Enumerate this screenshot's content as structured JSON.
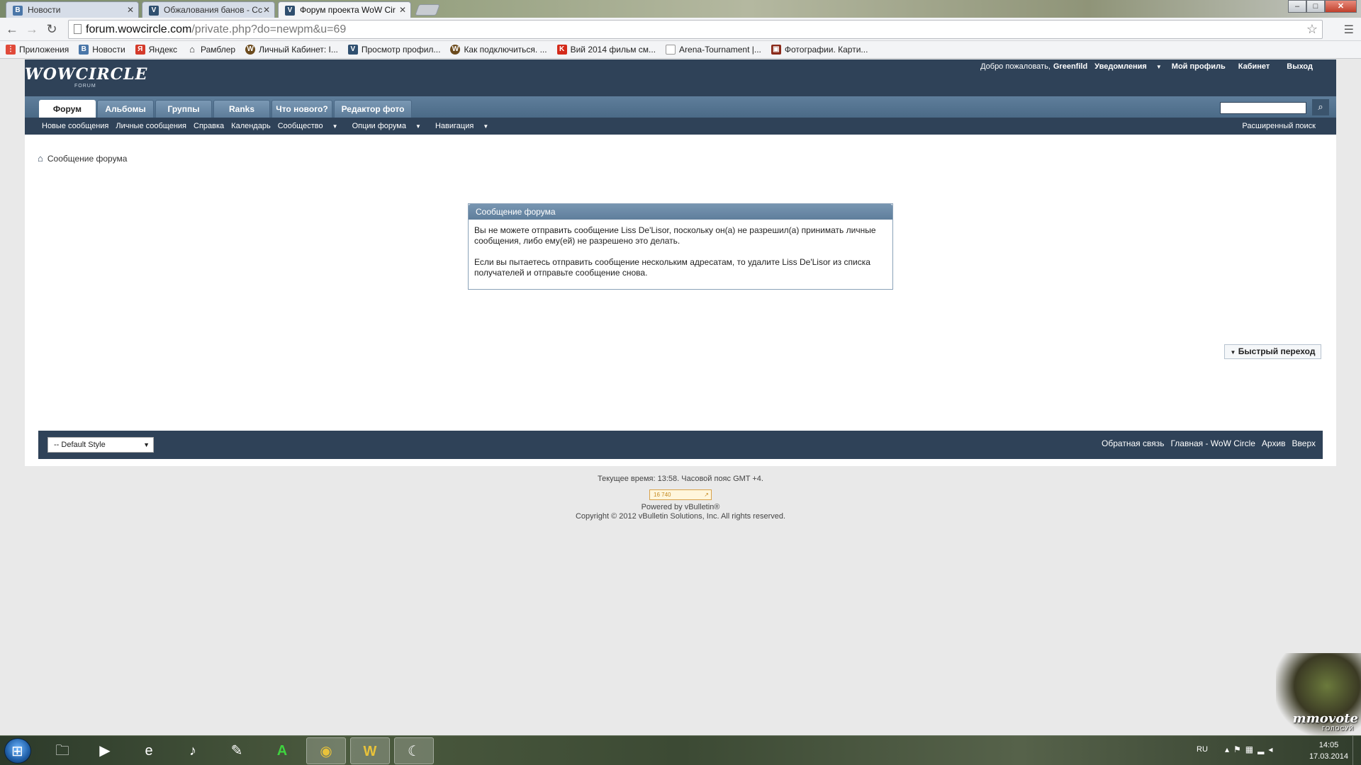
{
  "browser": {
    "tabs": [
      {
        "label": "Новости",
        "favicon": "vk-icon",
        "active": false
      },
      {
        "label": "Обжалования банов - Cc",
        "favicon": "vbulletin-icon",
        "active": false
      },
      {
        "label": "Форум проекта WoW Cir",
        "favicon": "vbulletin-icon",
        "active": true
      }
    ],
    "window_buttons": {
      "minimize": "–",
      "maximize": "□",
      "close": "✕"
    },
    "url_host": "forum.wowcircle.com",
    "url_path": "/private.php?do=newpm&u=69",
    "bookmarks": [
      {
        "label": "Приложения",
        "icon": "apps-grid-icon",
        "color": "#e04a3a"
      },
      {
        "label": "Новости",
        "icon": "vk-icon",
        "color": "#4a76a8"
      },
      {
        "label": "Яндекс",
        "icon": "yandex-icon",
        "color": "#d43a2a"
      },
      {
        "label": "Рамблер",
        "icon": "home-icon",
        "color": "#333333"
      },
      {
        "label": "Личный Кабинет: I...",
        "icon": "wow-icon",
        "color": "#6b4a1c"
      },
      {
        "label": "Просмотр профил...",
        "icon": "vbulletin-icon",
        "color": "#2f4f6f"
      },
      {
        "label": "Как подключиться. ...",
        "icon": "wow-icon",
        "color": "#6b4a1c"
      },
      {
        "label": "Вий 2014 фильм см...",
        "icon": "kinopoisk-icon",
        "color": "#d42a1a"
      },
      {
        "label": "Arena-Tournament |...",
        "icon": "page-icon",
        "color": "#ffffff"
      },
      {
        "label": "Фотографии. Карти...",
        "icon": "photo-icon",
        "color": "#8a2a1a"
      }
    ]
  },
  "forum": {
    "logo": "WOWCIRCLE",
    "logo_sub": "FORUM",
    "top_links": {
      "welcome": "Добро пожаловать,",
      "username": "Greenfild",
      "notifications": "Уведомления",
      "profile": "Мой профиль",
      "cabinet": "Кабинет",
      "logout": "Выход"
    },
    "nav_tabs": [
      "Форум",
      "Альбомы",
      "Группы",
      "Ranks",
      "Что нового?",
      "Редактор фото"
    ],
    "sub_nav": [
      "Новые сообщения",
      "Личные сообщения",
      "Справка",
      "Календарь",
      "Сообщество",
      "Опции форума",
      "Навигация"
    ],
    "advanced_search": "Расширенный поиск",
    "breadcrumb": "Сообщение форума",
    "message_box": {
      "title": "Сообщение форума",
      "paragraph1": "Вы не можете отправить сообщение Liss De'Lisor, поскольку он(а) не разрешил(а) принимать личные сообщения, либо ему(ей) не разрешено это делать.",
      "paragraph2": "Если вы пытаетесь отправить сообщение нескольким адресатам, то удалите Liss De'Lisor из списка получателей и отправьте сообщение снова."
    },
    "quick_nav": "Быстрый переход",
    "style_select": "-- Default Style",
    "footer_links": [
      "Обратная связь",
      "Главная - WoW Circle",
      "Архив",
      "Вверх"
    ],
    "time_line": "Текущее время: 13:58. Часовой пояс GMT +4.",
    "counter": "16 740",
    "powered_by": "Powered by vBulletin®",
    "copyright": "Copyright © 2012 vBulletin Solutions, Inc. All rights reserved."
  },
  "overlay": {
    "mmovote_title": "mmovote",
    "mmovote_sub": "ГОЛОСУЙ"
  },
  "taskbar": {
    "lang": "RU",
    "time": "14:05",
    "date": "17.03.2014",
    "items": [
      "explorer-icon",
      "media-player-icon",
      "internet-explorer-icon",
      "audio-icon",
      "paint-icon",
      "a-app-icon",
      "chrome-icon",
      "wow-icon",
      "launcher-icon"
    ]
  },
  "colors": {
    "header": "#2f4258",
    "nav": "#5f7e9b",
    "accent": "#7896b2"
  }
}
